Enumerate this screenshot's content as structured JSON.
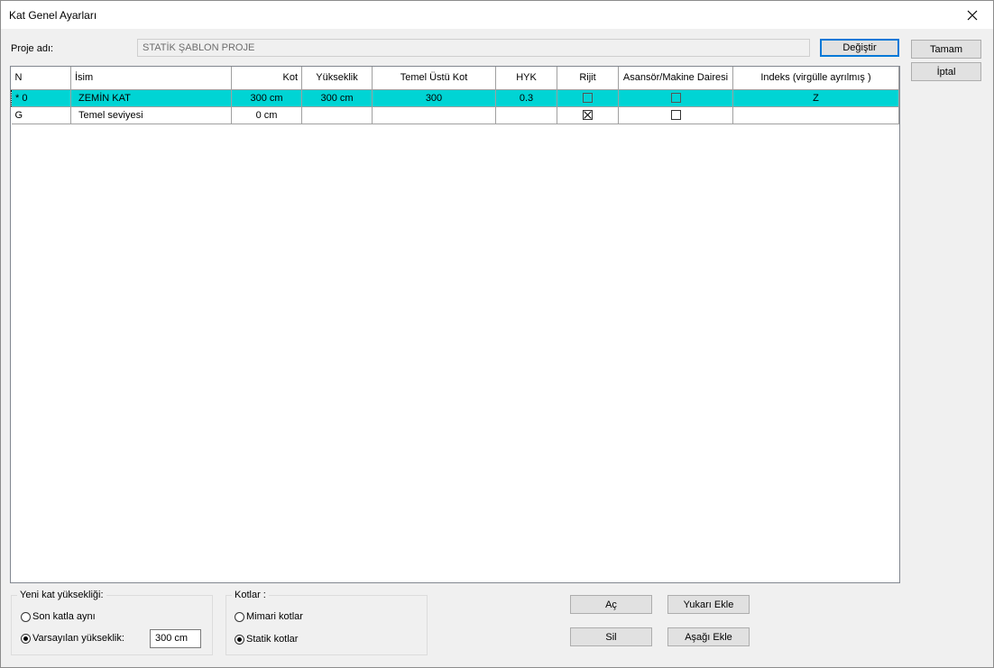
{
  "window": {
    "title": "Kat Genel Ayarları"
  },
  "project": {
    "label": "Proje adı:",
    "value": "STATİK ŞABLON PROJE",
    "change_button": "Değiştir"
  },
  "actions": {
    "ok": "Tamam",
    "cancel": "İptal"
  },
  "table": {
    "headers": [
      "N",
      "İsim",
      "Kot",
      "Yükseklik",
      "Temel Üstü Kot",
      "HYK",
      "Rijit",
      "Asansör/Makine Dairesi",
      "Indeks (virgülle ayrılmış )"
    ],
    "rows": [
      {
        "n": "* 0",
        "name": "ZEMİN KAT",
        "kot": "300 cm",
        "height": "300 cm",
        "foundation_top": "300",
        "hyk": "0.3",
        "rigid": false,
        "elevator": false,
        "index": "Z",
        "selected": true
      },
      {
        "n": "G",
        "name": "Temel seviyesi",
        "kot": "0 cm",
        "height": "",
        "foundation_top": "",
        "hyk": "",
        "rigid": true,
        "elevator": false,
        "index": "",
        "selected": false
      }
    ]
  },
  "new_floor": {
    "legend": "Yeni kat yüksekliği:",
    "option_last": "Son katla aynı",
    "option_default": "Varsayılan yükseklik:",
    "default_value": "300 cm",
    "selected": "default"
  },
  "levels": {
    "legend": "Kotlar :",
    "option_arch": "Mimari kotlar",
    "option_static": "Statik kotlar",
    "selected": "static"
  },
  "buttons": {
    "open": "Aç",
    "delete": "Sil",
    "add_above": "Yukarı Ekle",
    "add_below": "Aşağı Ekle"
  },
  "colors": {
    "selection": "#00d4d4",
    "accent": "#0078d7"
  }
}
